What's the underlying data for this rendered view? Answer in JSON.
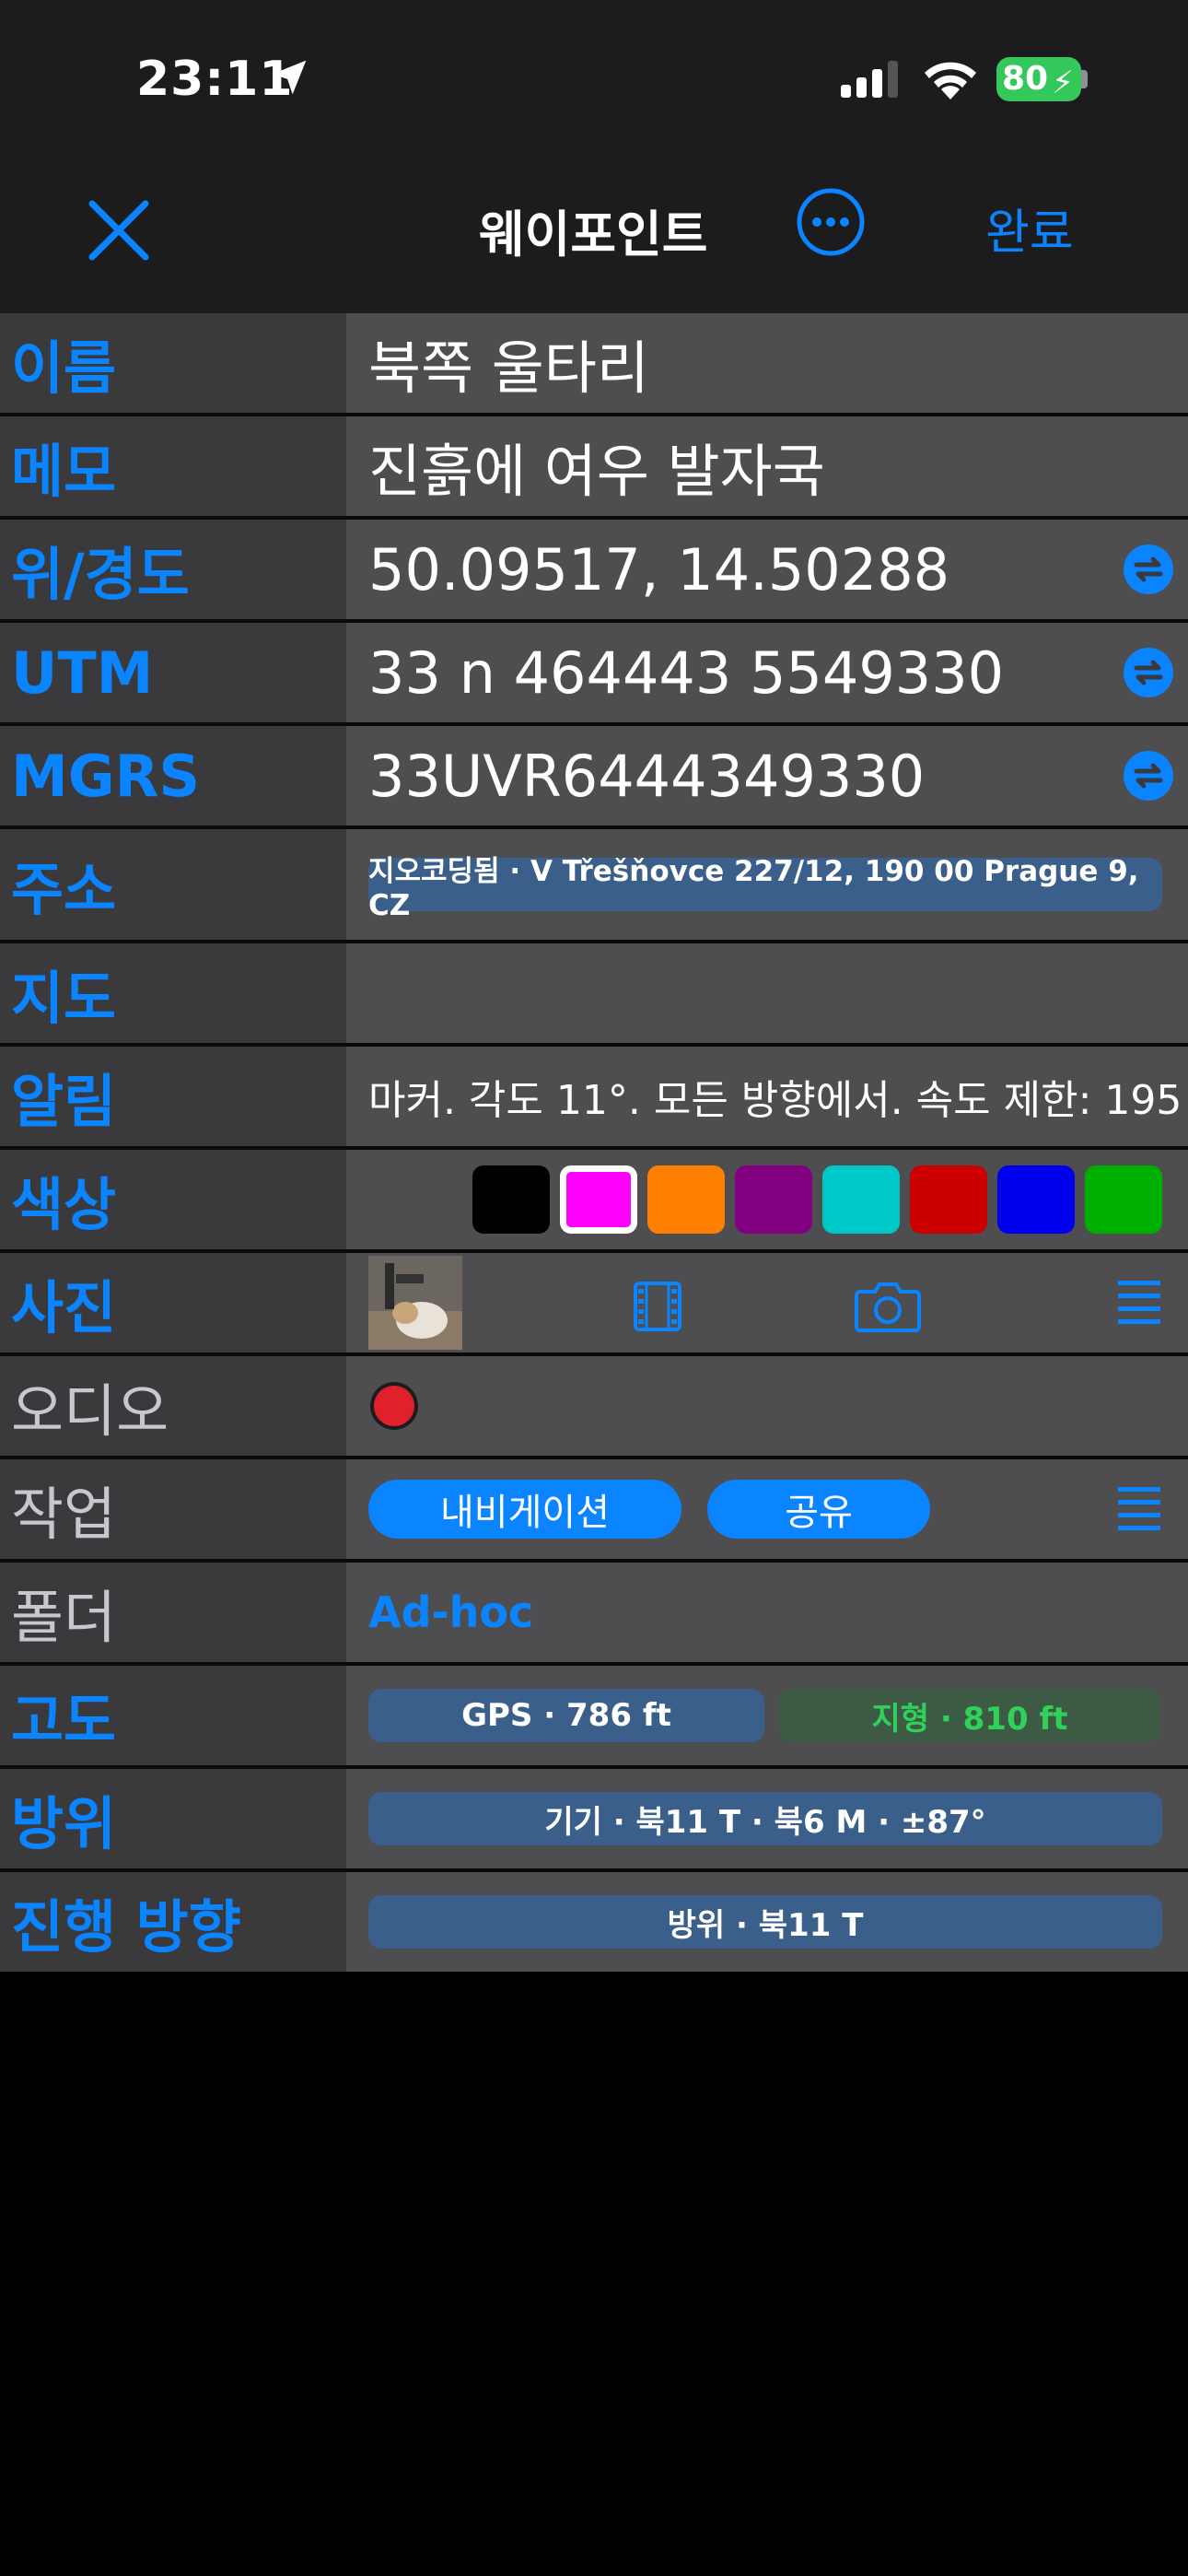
{
  "status_bar": {
    "time": "23:11",
    "battery": "80"
  },
  "nav": {
    "title": "웨이포인트",
    "done": "완료"
  },
  "rows": {
    "name": {
      "label": "이름",
      "value": "북쪽 울타리"
    },
    "memo": {
      "label": "메모",
      "value": "진흙에 여우 발자국"
    },
    "latlon": {
      "label": "위/경도",
      "value": "50.09517, 14.50288"
    },
    "utm": {
      "label": "UTM",
      "value": "33 n 464443 5549330"
    },
    "mgrs": {
      "label": "MGRS",
      "value": "33UVR6444349330"
    },
    "address": {
      "label": "주소",
      "value": "지오코딩됨 · V Třešňovce 227/12, 190 00 Prague 9, CZ"
    },
    "map": {
      "label": "지도"
    },
    "alert": {
      "label": "알림",
      "value": "마커. 각도 11°.  모든 방향에서. 속도 제한: 195"
    },
    "color": {
      "label": "색상",
      "swatches": [
        "#000000",
        "#ff00ff",
        "#ff8000",
        "#800080",
        "#00c8c8",
        "#cc0000",
        "#0000ee",
        "#00b000"
      ],
      "selected_index": 1
    },
    "photo": {
      "label": "사진"
    },
    "audio": {
      "label": "오디오"
    },
    "actions": {
      "label": "작업",
      "navigate": "내비게이션",
      "share": "공유"
    },
    "folder": {
      "label": "폴더",
      "value": "Ad-hoc"
    },
    "altitude": {
      "label": "고도",
      "gps": "GPS · 786 ft",
      "terrain": "지형 · 810 ft"
    },
    "bearing": {
      "label": "방위",
      "value": "기기 · 북11 T · 북6 M · ±87°"
    },
    "heading": {
      "label": "진행 방향",
      "value": "방위 · 북11 T"
    }
  },
  "colors": {
    "accent": "#0a84ff",
    "pill": "#3a5f8a",
    "terrain_pill": "#3d5a45",
    "terrain_text": "#30d158",
    "record": "#e0202a"
  }
}
